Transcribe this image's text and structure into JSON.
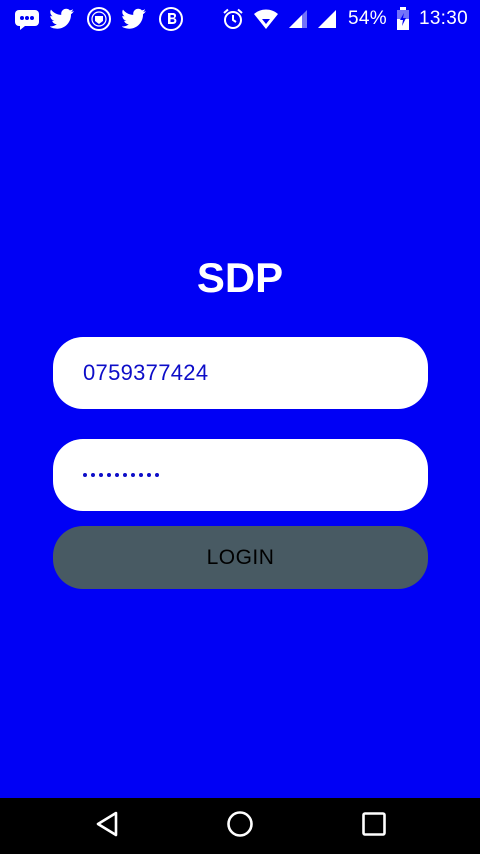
{
  "status_bar": {
    "left_icons": [
      "messenger-icon",
      "twitter-icon",
      "club-crest-icon",
      "twitter-icon",
      "bitcoin-icon"
    ],
    "right_icons": [
      "alarm-icon",
      "wifi-icon",
      "signal-icon",
      "signal-icon",
      "battery-charging-icon"
    ],
    "battery_percent": "54%",
    "time": "13:30"
  },
  "login": {
    "app_title": "SDP",
    "phone_value": "0759377424",
    "password_mask_length": 10,
    "login_label": "LOGIN"
  },
  "colors": {
    "background": "#0000f5",
    "field_background": "#ffffff",
    "field_text": "#0d0dc8",
    "button_background": "#485a63",
    "nav_bar": "#000000"
  },
  "nav_bar": {
    "buttons": [
      "back-icon",
      "home-icon",
      "recents-icon"
    ]
  }
}
